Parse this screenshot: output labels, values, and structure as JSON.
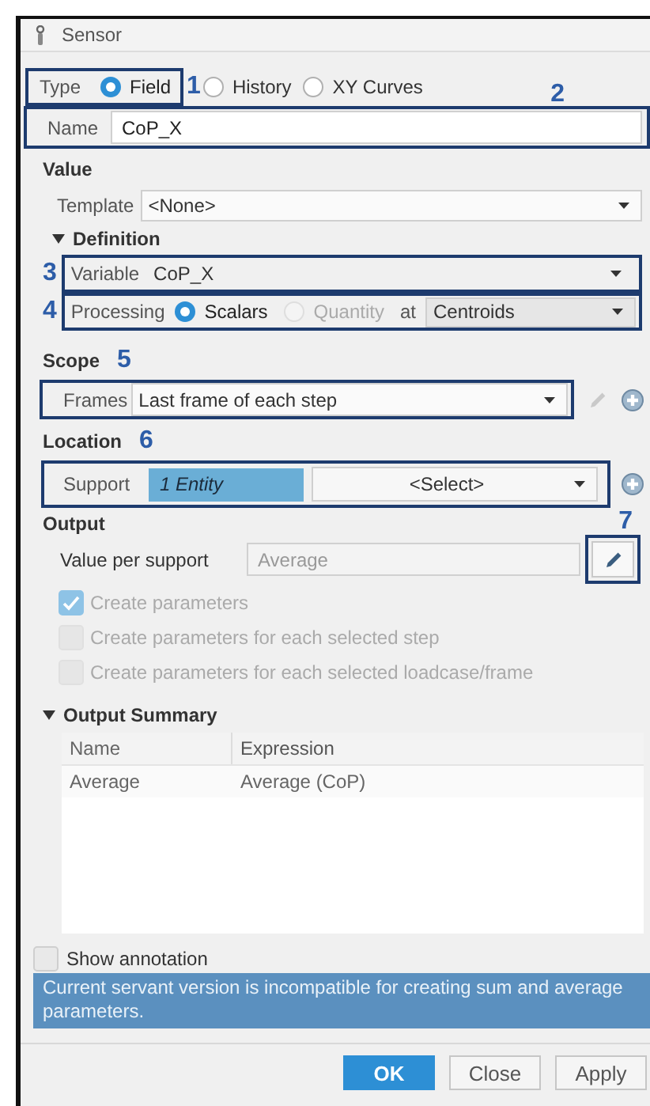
{
  "window": {
    "title": "Sensor"
  },
  "type": {
    "label": "Type",
    "marker": "1",
    "options": [
      {
        "label": "Field",
        "selected": true
      },
      {
        "label": "History",
        "selected": false
      },
      {
        "label": "XY Curves",
        "selected": false
      }
    ]
  },
  "name": {
    "label": "Name",
    "value": "CoP_X",
    "marker": "2"
  },
  "value": {
    "heading": "Value",
    "template": {
      "label": "Template",
      "value": "<None>"
    },
    "definition": {
      "heading": "Definition",
      "expanded": true,
      "variable": {
        "label": "Variable",
        "value": "CoP_X",
        "marker": "3"
      },
      "processing": {
        "label": "Processing",
        "marker": "4",
        "options": [
          {
            "label": "Scalars",
            "selected": true,
            "disabled": false
          },
          {
            "label": "Quantity",
            "selected": false,
            "disabled": true
          }
        ],
        "at_label": "at",
        "at_value": "Centroids"
      }
    }
  },
  "scope": {
    "heading": "Scope",
    "marker": "5",
    "frames": {
      "label": "Frames",
      "value": "Last frame of each step"
    }
  },
  "location": {
    "heading": "Location",
    "marker": "6",
    "support": {
      "label": "Support",
      "entity": "1 Entity",
      "select": "<Select>"
    }
  },
  "output": {
    "heading": "Output",
    "value_per_support": {
      "label": "Value per support",
      "value": "Average",
      "marker": "7"
    },
    "options": [
      {
        "label": "Create parameters",
        "checked": true,
        "disabled": true
      },
      {
        "label": "Create parameters for each selected step",
        "checked": false,
        "disabled": true
      },
      {
        "label": "Create parameters for each selected loadcase/frame",
        "checked": false,
        "disabled": true
      }
    ]
  },
  "output_summary": {
    "heading": "Output Summary",
    "expanded": true,
    "columns": [
      "Name",
      "Expression"
    ],
    "rows": [
      [
        "Average",
        "Average (CoP)"
      ]
    ]
  },
  "show_annotation": {
    "label": "Show annotation",
    "checked": false
  },
  "message": "Current servant version is incompatible for creating sum and average parameters.",
  "buttons": [
    {
      "label": "OK",
      "kind": "primary"
    },
    {
      "label": "Close",
      "kind": "normal"
    },
    {
      "label": "Apply",
      "kind": "normal"
    }
  ]
}
